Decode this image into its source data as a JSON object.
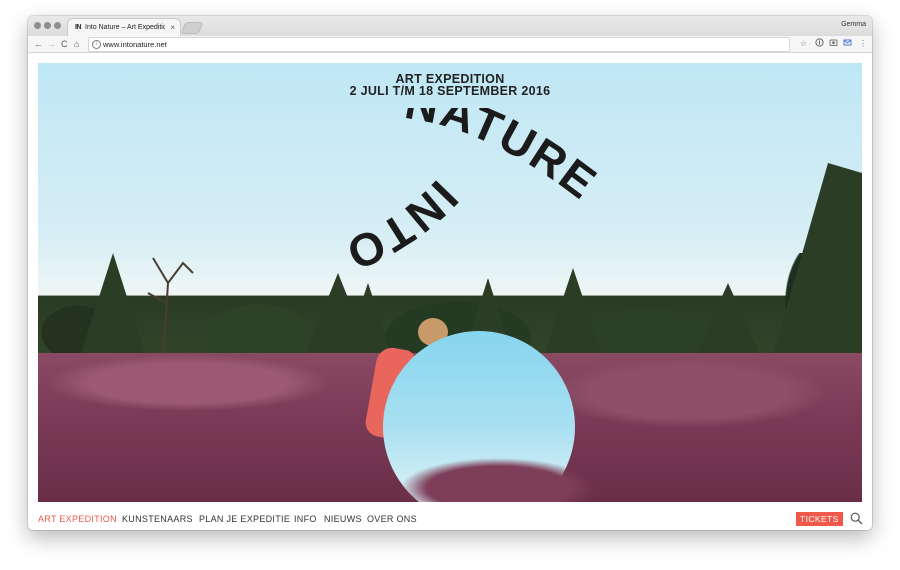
{
  "browser": {
    "tab_favicon": "IN",
    "tab_title": "Into Nature – Art Expedition – ...",
    "tab_close": "×",
    "user_name": "Gemma",
    "url": "www.intonature.net",
    "nav": {
      "back": "←",
      "forward": "→",
      "reload": "C",
      "home": "⌂"
    },
    "icons": {
      "bookmark": "☆",
      "menu": "⋮"
    }
  },
  "hero": {
    "title_line1": "ART EXPEDITION",
    "title_line2": "2 JULI T/M 18 SEPTEMBER 2016",
    "logo_word_left": "INTO",
    "logo_word_right": "NATURE"
  },
  "nav": {
    "items": [
      {
        "label": "ART EXPEDITION",
        "active": true
      },
      {
        "label": "KUNSTENAARS"
      },
      {
        "label": "PLAN JE EXPEDITIE"
      },
      {
        "label": "INFO"
      },
      {
        "label": "NIEUWS"
      },
      {
        "label": "OVER ONS"
      }
    ],
    "tickets_label": "TICKETS"
  },
  "colors": {
    "accent": "#f0584a",
    "text": "#222222"
  }
}
